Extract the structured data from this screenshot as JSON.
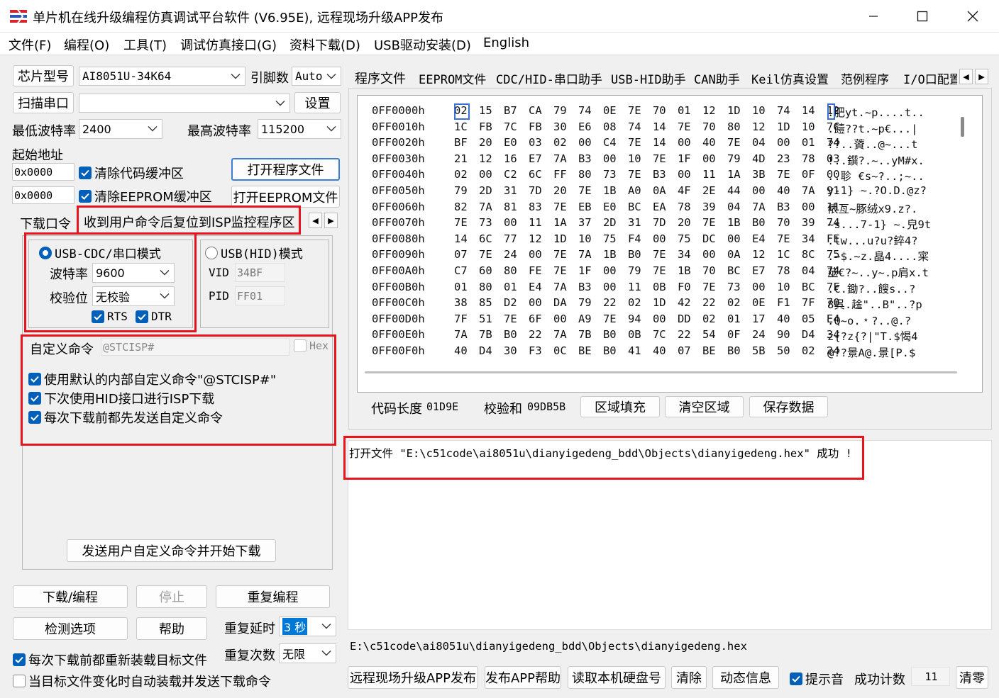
{
  "window": {
    "title": "单片机在线升级编程仿真调试平台软件 (V6.95E), 远程现场升级APP发布"
  },
  "menu": [
    "文件(F)",
    "编程(O)",
    "工具(T)",
    "调试仿真接口(G)",
    "资料下载(D)",
    "USB驱动安装(D)",
    "English"
  ],
  "left": {
    "chip_label": "芯片型号",
    "chip_value": "AI8051U-34K64",
    "pins_label": "引脚数",
    "pins_value": "Auto",
    "scan_port_label": "扫描串口",
    "port_value": "",
    "settings_label": "设置",
    "min_baud_label": "最低波特率",
    "min_baud_value": "2400",
    "max_baud_label": "最高波特率",
    "max_baud_value": "115200",
    "start_addr_label": "起始地址",
    "code_addr_value": "0x0000",
    "clear_code_label": "清除代码缓冲区",
    "eeprom_addr_value": "0x0000",
    "clear_eeprom_label": "清除EEPROM缓冲区",
    "open_program_label": "打开程序文件",
    "open_eeprom_label": "打开EEPROM文件"
  },
  "subtabs": {
    "download_port": "下载口令",
    "reset_isp": "收到用户命令后复位到ISP监控程序区"
  },
  "mode": {
    "cdc_label": "USB-CDC/串口模式",
    "baud_label": "波特率",
    "baud_value": "9600",
    "parity_label": "校验位",
    "parity_value": "无校验",
    "rts_label": "RTS",
    "dtr_label": "DTR",
    "hid_label": "USB(HID)模式",
    "vid_label": "VID",
    "vid_value": "34BF",
    "pid_label": "PID",
    "pid_value": "FF01"
  },
  "custom": {
    "label": "自定义命令",
    "value": "@STCISP#",
    "hex_label": "Hex",
    "opt1": "使用默认的内部自定义命令\"@STCISP#\"",
    "opt2": "下次使用HID接口进行ISP下载",
    "opt3": "每次下载前都先发送自定义命令",
    "send_button": "发送用户自定义命令并开始下载"
  },
  "actions": {
    "download": "下载/编程",
    "stop": "停止",
    "reprogram": "重复编程",
    "check_options": "检测选项",
    "help": "帮助",
    "repeat_delay_label": "重复延时",
    "repeat_delay_value": "3 秒",
    "repeat_count_label": "重复次数",
    "repeat_count_value": "无限",
    "reload_label": "每次下载前都重新装载目标文件",
    "auto_load_label": "当目标文件变化时自动装载并发送下载命令"
  },
  "tabs": [
    "程序文件",
    "EEPROM文件",
    "CDC/HID-串口助手",
    "USB-HID助手",
    "CAN助手",
    "Keil仿真设置",
    "范例程序",
    "I/O口配置"
  ],
  "hex": {
    "rows": [
      {
        "addr": "0FF0000h",
        "bytes": "02 15 B7 CA 79 74 0E 7E 70 01 12 1D 10 74 14 12",
        "ascii": ".肥yt.~p....t.."
      },
      {
        "addr": "0FF0010h",
        "bytes": "1C FB 7C FB 30 E6 08 74 14 7E 70 80 12 1D 10 7C",
        "ascii": ".饐??t.~p€...|"
      },
      {
        "addr": "0FF0020h",
        "bytes": "BF 20 E0 03 02 00 C4 7E 14 00 40 7E 04 00 01 74",
        "ascii": "??..薋..@~...t"
      },
      {
        "addr": "0FF0030h",
        "bytes": "21 12 16 E7 7A B3 00 10 7E 1F 00 79 4D 23 78 03",
        "ascii": "!..鐉?.~..yM#x."
      },
      {
        "addr": "0FF0040h",
        "bytes": "02 00 C2 6C FF 80 73 7E B3 00 11 1A 3B 7E 0F 00",
        "ascii": "..聄 €s~?..;~.."
      },
      {
        "addr": "0FF0050h",
        "bytes": "79 2D 31 7D 20 7E 1B A0 0A 4F 2E 44 00 40 7A 91",
        "ascii": "y-1} ~.?O.D.@z?"
      },
      {
        "addr": "0FF0060h",
        "bytes": "82 7A 81 83 7E EB E0 BC EA 78 39 04 7A B3 00 11",
        "ascii": "俵亙~豚绒x9.z?."
      },
      {
        "addr": "0FF0070h",
        "bytes": "7E 73 00 11 1A 37 2D 31 7D 20 7E 1B B0 70 39 74",
        "ascii": "~s...7-1} ~.皃9t"
      },
      {
        "addr": "0FF0080h",
        "bytes": "14 6C 77 12 1D 10 75 F4 00 75 DC 00 E4 7E 34 FE",
        "ascii": ".lw...u?u?錊4?"
      },
      {
        "addr": "0FF0090h",
        "bytes": "07 7E 24 00 7E 7A 1B B0 7E 34 00 0A 12 1C 8C 75",
        "ascii": ".~$.~z.皛4....寀"
      },
      {
        "addr": "0FF00A0h",
        "bytes": "C7 60 80 FE 7E 1F 00 79 7E 1B 70 BC E7 78 04 74",
        "ascii": "莁€?~..y~.p肩x.t"
      },
      {
        "addr": "0FF00B0h",
        "bytes": "01 80 01 E4 7A B3 00 11 0B F0 7E 73 00 10 BC 7F",
        "ascii": ".€.鋤?..餿s..?"
      },
      {
        "addr": "0FF00C0h",
        "bytes": "38 85 D2 00 DA 79 22 02 1D 42 22 02 0E F1 7F 70",
        "ascii": "8呉.趛\"..B\"..?p"
      },
      {
        "addr": "0FF00D0h",
        "bytes": "7F 51 7E 6F 00 A9 7E 94 00 DD 02 01 17 40 05 E4",
        "ascii": ".Q~o.﹡?..@.?"
      },
      {
        "addr": "0FF00E0h",
        "bytes": "7A 7B B0 22 7A 7B B0 0B 7C 22 54 0F 24 90 D4 34",
        "ascii": "z{?z{?|\"T.$愒4"
      },
      {
        "addr": "0FF00F0h",
        "bytes": "40 D4 30 F3 0C BE B0 41 40 07 BE B0 5B 50 02 24",
        "ascii": "@??景A@.景[P.$"
      }
    ],
    "code_length_label": "代码长度",
    "code_length_value": "01D9E",
    "checksum_label": "校验和",
    "checksum_value": "09DB5B",
    "fill_button": "区域填充",
    "clear_button": "清空区域",
    "save_button": "保存数据"
  },
  "log": {
    "message": "打开文件 \"E:\\c51code\\ai8051u\\dianyigedeng_bdd\\Objects\\dianyigedeng.hex\" 成功 !",
    "path": "E:\\c51code\\ai8051u\\dianyigedeng_bdd\\Objects\\dianyigedeng.hex"
  },
  "bottom": {
    "remote_app": "远程现场升级APP发布",
    "app_help": "发布APP帮助",
    "read_disk": "读取本机硬盘号",
    "clear": "清除",
    "dynamic_info": "动态信息",
    "beep_label": "提示音",
    "success_count_label": "成功计数",
    "success_count_value": "11",
    "reset_count": "清零"
  },
  "colors": {
    "accent": "#005fb8",
    "highlight": "#e8141c"
  }
}
